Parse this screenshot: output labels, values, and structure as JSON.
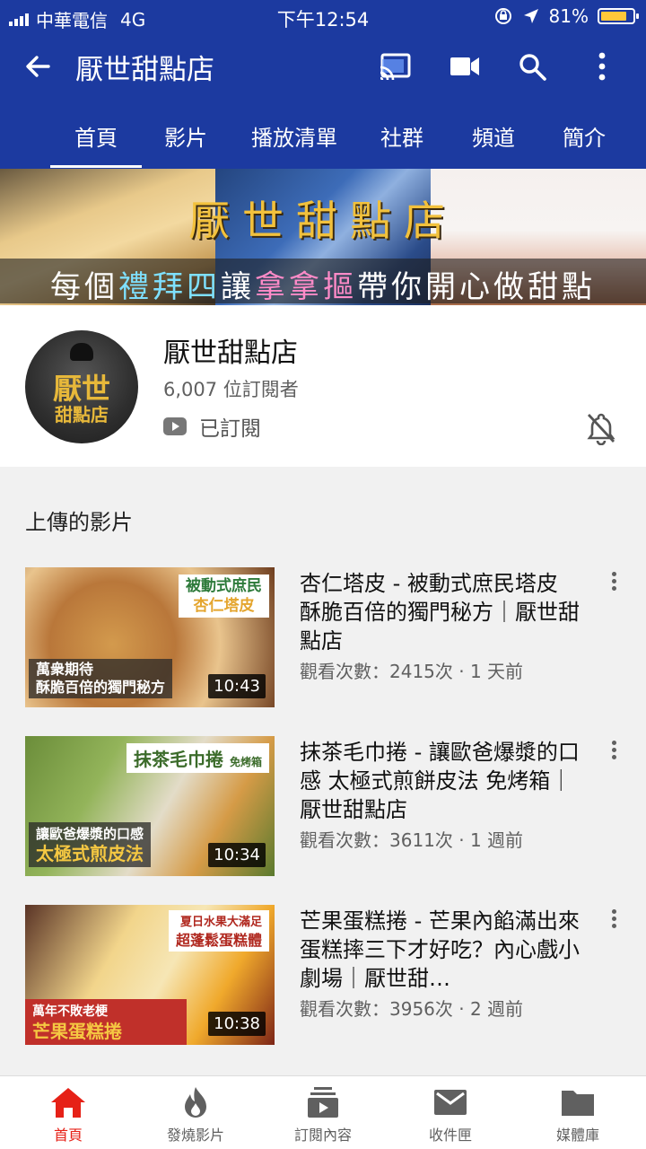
{
  "status_bar": {
    "carrier": "中華電信",
    "network": "4G",
    "time": "下午12:54",
    "battery": "81%"
  },
  "app_bar": {
    "title": "厭世甜點店",
    "icons": [
      "back-arrow-icon",
      "cast-icon",
      "video-camera-icon",
      "search-icon",
      "more-vert-icon"
    ]
  },
  "tabs": [
    {
      "label": "首頁",
      "active": true
    },
    {
      "label": "影片"
    },
    {
      "label": "播放清單"
    },
    {
      "label": "社群"
    },
    {
      "label": "頻道"
    },
    {
      "label": "簡介"
    }
  ],
  "banner": {
    "title": "厭世甜點店",
    "subtitle_parts": [
      "每個",
      "禮拜四",
      "讓",
      "拿拿摳",
      "帶你開心做甜點"
    ]
  },
  "channel": {
    "avatar_line1": "厭世",
    "avatar_line2": "甜點店",
    "name": "厭世甜點店",
    "subscribers": "6,007 位訂閱者",
    "subscribed_label": "已訂閱"
  },
  "uploads": {
    "heading": "上傳的影片",
    "videos": [
      {
        "title": "杏仁塔皮 - 被動式庶民塔皮 酥脆百倍的獨門秘方｜厭世甜點店",
        "meta": "觀看次數：2415次 · 1 天前",
        "duration": "10:43",
        "thumb_top": "被動式庶民",
        "thumb_top2": "杏仁塔皮",
        "thumb_bottom1": "萬衆期待",
        "thumb_bottom2": "酥脆百倍的獨門秘方"
      },
      {
        "title": "抹茶毛巾捲 - 讓歐爸爆漿的口感 太極式煎餅皮法 免烤箱｜厭世甜點店",
        "meta": "觀看次數：3611次 · 1 週前",
        "duration": "10:34",
        "thumb_top": "抹茶毛巾捲",
        "thumb_top2": "免烤箱",
        "thumb_bottom1": "讓歐爸爆漿的口感",
        "thumb_bottom2": "太極式煎皮法"
      },
      {
        "title": "芒果蛋糕捲 - 芒果內餡滿出來 蛋糕摔三下才好吃？內心戲小劇場｜厭世甜…",
        "meta": "觀看次數：3956次 · 2 週前",
        "duration": "10:38",
        "thumb_top": "夏日水果大滿足",
        "thumb_top2": "超蓬鬆蛋糕體",
        "thumb_bottom1": "萬年不敗老梗",
        "thumb_bottom2": "芒果蛋糕捲"
      }
    ]
  },
  "bottom_nav": [
    {
      "label": "首頁",
      "icon": "home-icon",
      "active": true
    },
    {
      "label": "發燒影片",
      "icon": "trending-flame-icon"
    },
    {
      "label": "訂閱內容",
      "icon": "subscriptions-icon"
    },
    {
      "label": "收件匣",
      "icon": "inbox-mail-icon"
    },
    {
      "label": "媒體庫",
      "icon": "library-folder-icon"
    }
  ],
  "colors": {
    "header_blue": "#1c3aa0",
    "active_red": "#e62117",
    "battery_yellow": "#ffc83a"
  }
}
